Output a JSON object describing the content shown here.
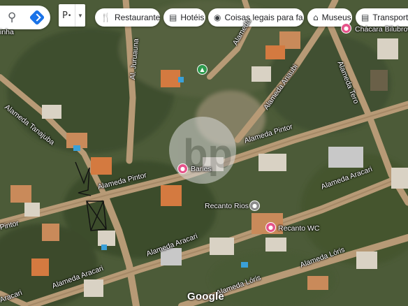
{
  "toolbar": {
    "search_icon": "search-icon",
    "directions_icon": "directions-icon",
    "layer_button_label": "P"
  },
  "chips": [
    {
      "icon": "restaurant-icon",
      "label": "Restaurantes"
    },
    {
      "icon": "hotel-icon",
      "label": "Hotéis"
    },
    {
      "icon": "camera-icon",
      "label": "Coisas legais para fa..."
    },
    {
      "icon": "museum-icon",
      "label": "Museus"
    },
    {
      "icon": "transit-icon",
      "label": "Transporte"
    }
  ],
  "streets": {
    "tanajuba": "Alameda Tanajuba",
    "pintor_left": "Alameda Pintor",
    "pintor_right": "Alameda Pintor",
    "pintor_edge": "Pintor",
    "aracari_center": "Alameda Aracari",
    "aracari_right": "Alameda Aracari",
    "aracari_left": "Alameda Aracari",
    "aracari_edge": "Aracari",
    "loris_center": "Alameda Lóris",
    "loris_right": "Alameda Lóris",
    "jurutauna": "Al. Juruauna",
    "anaubi": "Alameda Anaubi",
    "tero": "Alameda Tero",
    "alameda_top": "Alameda",
    "inha": "inha"
  },
  "places": {
    "chacara": "Chácara Bilubrow",
    "baries": "Baries",
    "recanto_rios": "Recanto Rios",
    "recanto_wc": "Recanto WC"
  },
  "attribution": "Google"
}
